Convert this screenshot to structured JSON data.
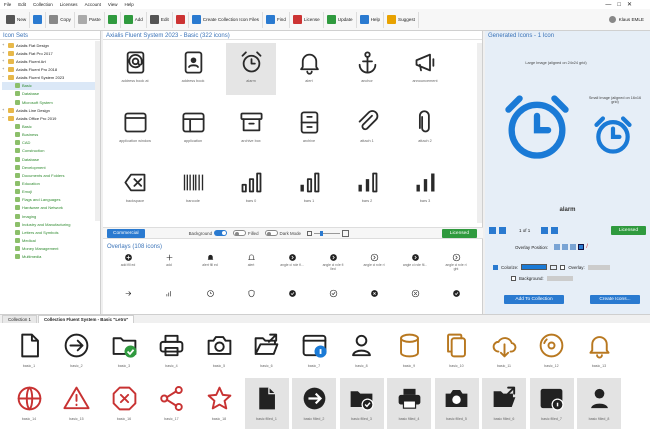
{
  "menu": [
    "File",
    "Edit",
    "Collection",
    "Licenses",
    "Account",
    "View",
    "Help"
  ],
  "user": "Klaus EMLE",
  "toolbar": [
    {
      "label": "New",
      "icon": "new-file-icon",
      "color": "#555"
    },
    {
      "label": "",
      "icon": "save-icon",
      "color": "#2a7ad0"
    },
    {
      "label": "Copy",
      "icon": "copy-icon",
      "color": "#888"
    },
    {
      "label": "Paste",
      "icon": "paste-icon",
      "color": "#aaa"
    },
    {
      "label": "",
      "icon": "undo-icon",
      "color": "#2f9a3e"
    },
    {
      "label": "Add",
      "icon": "add-icon",
      "color": "#2f9a3e"
    },
    {
      "label": "Edit",
      "icon": "edit-icon",
      "color": "#555"
    },
    {
      "label": "",
      "icon": "delete-icon",
      "color": "#c33"
    },
    {
      "label": "Create Collection Icon Files",
      "icon": "create-files-icon",
      "color": "#2a7ad0"
    },
    {
      "label": "Find",
      "icon": "find-icon",
      "color": "#2a7ad0"
    },
    {
      "label": "License",
      "icon": "license-icon",
      "color": "#c33"
    },
    {
      "label": "Update",
      "icon": "update-icon",
      "color": "#2f9a3e"
    },
    {
      "label": "Help",
      "icon": "help-icon",
      "color": "#2a7ad0"
    },
    {
      "label": "Suggest",
      "icon": "suggest-icon",
      "color": "#e8a200"
    }
  ],
  "iconsets": {
    "title": "Icon Sets",
    "items": [
      {
        "t": "Axialis Flat Design",
        "k": "f",
        "lvl": 0
      },
      {
        "t": "Axialis Flat Pro 2017",
        "k": "f",
        "lvl": 0
      },
      {
        "t": "Axialis Fluent Art",
        "k": "f",
        "lvl": 0
      },
      {
        "t": "Axialis Fluent Pro 2018",
        "k": "f",
        "lvl": 0
      },
      {
        "t": "Axialis Fluent System 2023",
        "k": "f",
        "lvl": 0,
        "open": true
      },
      {
        "t": "Basic",
        "k": "g",
        "lvl": 1,
        "sel": true
      },
      {
        "t": "Database",
        "k": "g",
        "lvl": 1
      },
      {
        "t": "Microsoft System",
        "k": "g",
        "lvl": 1
      },
      {
        "t": "Axialis Line Design",
        "k": "f",
        "lvl": 0
      },
      {
        "t": "Axialis Office Pro 2019",
        "k": "f",
        "lvl": 0,
        "open": true
      },
      {
        "t": "Basic",
        "k": "g",
        "lvl": 1
      },
      {
        "t": "Business",
        "k": "g",
        "lvl": 1
      },
      {
        "t": "CAD",
        "k": "g",
        "lvl": 1
      },
      {
        "t": "Construction",
        "k": "g",
        "lvl": 1
      },
      {
        "t": "Database",
        "k": "g",
        "lvl": 1
      },
      {
        "t": "Development",
        "k": "g",
        "lvl": 1
      },
      {
        "t": "Documents and Folders",
        "k": "g",
        "lvl": 1
      },
      {
        "t": "Education",
        "k": "g",
        "lvl": 1
      },
      {
        "t": "Emoji",
        "k": "g",
        "lvl": 1
      },
      {
        "t": "Flags and Languages",
        "k": "g",
        "lvl": 1
      },
      {
        "t": "Hardware and Network",
        "k": "g",
        "lvl": 1
      },
      {
        "t": "Imaging",
        "k": "g",
        "lvl": 1
      },
      {
        "t": "Industry and Manufacturing",
        "k": "g",
        "lvl": 1
      },
      {
        "t": "Letters and Symbols",
        "k": "g",
        "lvl": 1
      },
      {
        "t": "Medical",
        "k": "g",
        "lvl": 1
      },
      {
        "t": "Money Management",
        "k": "g",
        "lvl": 1
      },
      {
        "t": "Multimedia",
        "k": "g",
        "lvl": 1
      }
    ]
  },
  "center": {
    "title": "Axialis Fluent System 2023 - Basic (322 icons)",
    "icons": [
      {
        "l": "address book at",
        "s": "book-at"
      },
      {
        "l": "address book",
        "s": "book-person"
      },
      {
        "l": "alarm",
        "s": "alarm",
        "sel": true
      },
      {
        "l": "alert",
        "s": "bell"
      },
      {
        "l": "anchor",
        "s": "anchor"
      },
      {
        "l": "announcement",
        "s": "megaphone"
      },
      {
        "l": "application window",
        "s": "appwin"
      },
      {
        "l": "application",
        "s": "app"
      },
      {
        "l": "archive box",
        "s": "archive"
      },
      {
        "l": "archive",
        "s": "archive2"
      },
      {
        "l": "attach 1",
        "s": "clip"
      },
      {
        "l": "attach 2",
        "s": "clip2"
      },
      {
        "l": "backspace",
        "s": "backspace"
      },
      {
        "l": "barcode",
        "s": "barcode"
      },
      {
        "l": "bars 0",
        "s": "bars0"
      },
      {
        "l": "bars 1",
        "s": "bars1"
      },
      {
        "l": "bars 2",
        "s": "bars2"
      },
      {
        "l": "bars 3",
        "s": "bars3"
      }
    ],
    "controls": {
      "commercial": "Commercial",
      "background": "Background",
      "filled": "Filled",
      "dark": "Dark Mode",
      "licensed": "Licensed"
    },
    "overlays_title": "Overlays (108 icons)",
    "overlays": [
      {
        "l": "add fill ed",
        "s": "o-plus"
      },
      {
        "l": "add",
        "s": "o-plusline"
      },
      {
        "l": "alert fill ed",
        "s": "o-bell"
      },
      {
        "l": "alert",
        "s": "o-bellline"
      },
      {
        "l": "angle ci rcle fi...",
        "s": "o-chev"
      },
      {
        "l": "angle ci rcle fi lled",
        "s": "o-chev"
      },
      {
        "l": "angle ci rcle ri",
        "s": "o-chevline"
      },
      {
        "l": "angle ci rcle fil...",
        "s": "o-chev"
      },
      {
        "l": "angle ci rcle ri ght",
        "s": "o-chevline"
      },
      {
        "l": "",
        "s": "o-arrow"
      },
      {
        "l": "",
        "s": "o-bars"
      },
      {
        "l": "",
        "s": "o-clock"
      },
      {
        "l": "",
        "s": "o-shield"
      },
      {
        "l": "",
        "s": "o-check"
      },
      {
        "l": "",
        "s": "o-check2"
      },
      {
        "l": "",
        "s": "o-x"
      },
      {
        "l": "",
        "s": "o-xline"
      },
      {
        "l": "",
        "s": "o-check"
      }
    ]
  },
  "generated": {
    "title": "Generated Icons - 1 Icon",
    "large": "Large Image (aligned on 24x24 grid)",
    "small": "Small Image (aligned on 16x16 grid)",
    "name": "alarm",
    "nav": "1 of 1",
    "licensed": "Licensed",
    "overlay_position": "Overlay Position:",
    "colorize": "Colorize:",
    "overlay": "Overlay:",
    "background": "Background:",
    "add": "Add To Collection",
    "create": "Create Icons...",
    "accent": "#1a7ad6"
  },
  "tabs": [
    "Collection 1",
    "Collection Fluent System - Basic \"Letro\""
  ],
  "bottom": [
    {
      "l": "basic_1",
      "s": "b-doc",
      "c": "#222"
    },
    {
      "l": "basic_2",
      "s": "b-arrow",
      "c": "#222"
    },
    {
      "l": "basic_3",
      "s": "b-foldercheck",
      "c": "#222"
    },
    {
      "l": "basic_4",
      "s": "b-printer",
      "c": "#222"
    },
    {
      "l": "basic_5",
      "s": "b-camera",
      "c": "#222"
    },
    {
      "l": "basic_6",
      "s": "b-folderopen",
      "c": "#222"
    },
    {
      "l": "basic_7",
      "s": "b-appinfo",
      "c": "#222"
    },
    {
      "l": "basic_8",
      "s": "b-person",
      "c": "#222"
    },
    {
      "l": "basic_9",
      "s": "b-db",
      "c": "#b87820"
    },
    {
      "l": "basic_10",
      "s": "b-copy",
      "c": "#b87820"
    },
    {
      "l": "basic_11",
      "s": "b-cloud",
      "c": "#b87820"
    },
    {
      "l": "basic_12",
      "s": "b-disc",
      "c": "#b87820"
    },
    {
      "l": "basic_13",
      "s": "b-bell",
      "c": "#b87820"
    },
    {
      "l": "basic_14",
      "s": "b-globe",
      "c": "#c83232"
    },
    {
      "l": "basic_15",
      "s": "b-warn",
      "c": "#c83232"
    },
    {
      "l": "basic_16",
      "s": "b-stop",
      "c": "#c83232"
    },
    {
      "l": "basic_17",
      "s": "b-share",
      "c": "#c83232"
    },
    {
      "l": "basic_18",
      "s": "b-star",
      "c": "#c83232"
    },
    {
      "l": "basic filled_1",
      "s": "b-docf",
      "c": "#222",
      "sel": true
    },
    {
      "l": "basic filled_2",
      "s": "b-arrowf",
      "c": "#222",
      "sel": true
    },
    {
      "l": "basic filled_3",
      "s": "b-folderf",
      "c": "#222",
      "sel": true
    },
    {
      "l": "basic filled_4",
      "s": "b-printerf",
      "c": "#222",
      "sel": true
    },
    {
      "l": "basic filled_5",
      "s": "b-cameraf",
      "c": "#222",
      "sel": true
    },
    {
      "l": "basic filled_6",
      "s": "b-folderopenf",
      "c": "#222",
      "sel": true
    },
    {
      "l": "basic filled_7",
      "s": "b-appf",
      "c": "#222",
      "sel": true
    },
    {
      "l": "basic filled_8",
      "s": "b-personf",
      "c": "#222",
      "sel": true
    }
  ]
}
